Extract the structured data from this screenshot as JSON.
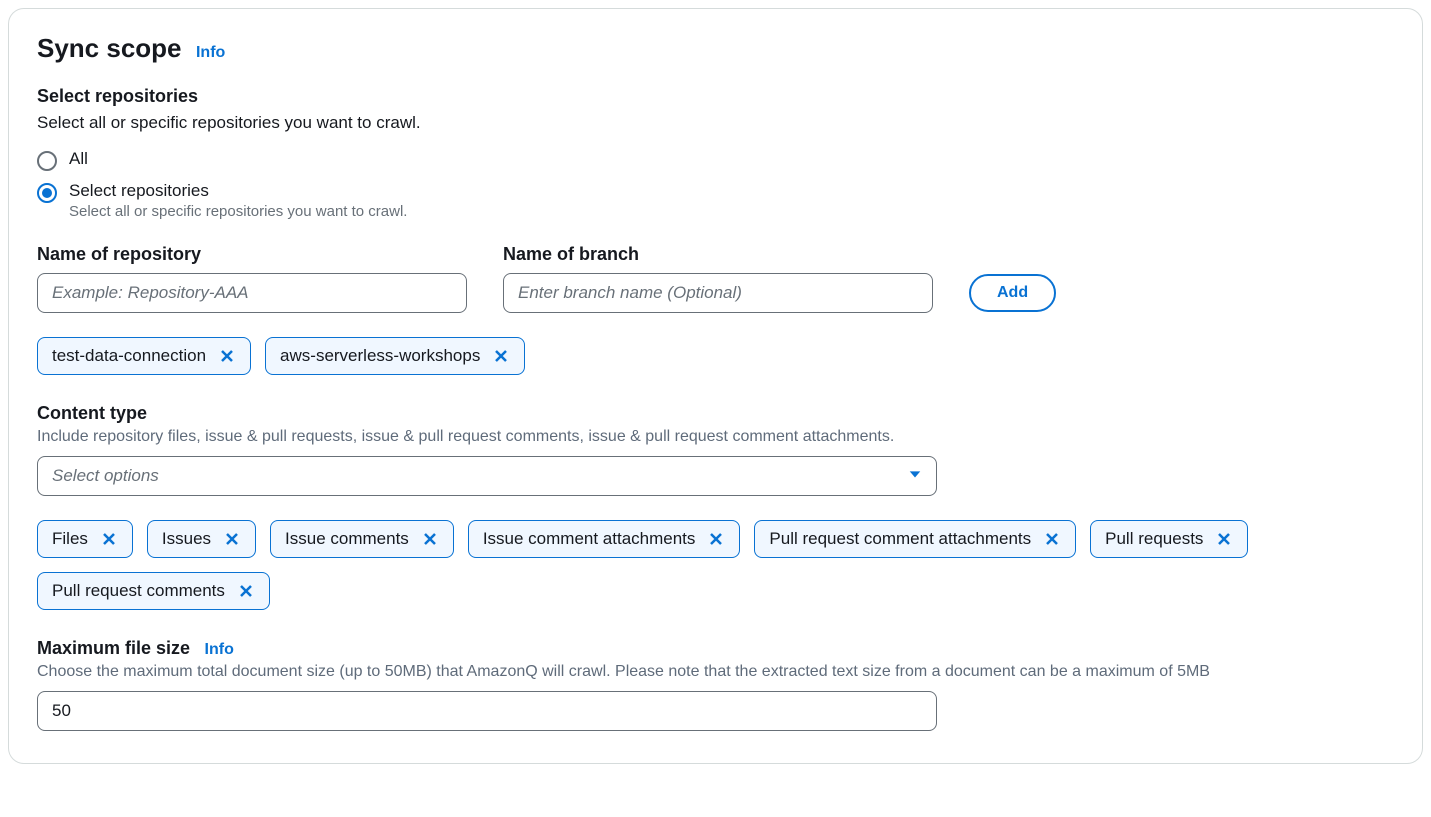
{
  "title": "Sync scope",
  "info_label": "Info",
  "select_repos": {
    "heading": "Select repositories",
    "description": "Select all or specific repositories you want to crawl.",
    "options": [
      {
        "label": "All",
        "selected": false
      },
      {
        "label": "Select repositories",
        "sublabel": "Select all or specific repositories you want to crawl.",
        "selected": true
      }
    ]
  },
  "repo_field": {
    "label": "Name of repository",
    "placeholder": "Example: Repository-AAA",
    "value": ""
  },
  "branch_field": {
    "label": "Name of branch",
    "placeholder": "Enter branch name (Optional)",
    "value": ""
  },
  "add_button": "Add",
  "repo_tokens": [
    "test-data-connection",
    "aws-serverless-workshops"
  ],
  "content_type": {
    "heading": "Content type",
    "description": "Include repository files, issue & pull requests, issue & pull request comments, issue & pull request comment attachments.",
    "select_placeholder": "Select options",
    "tokens": [
      "Files",
      "Issues",
      "Issue comments",
      "Issue comment attachments",
      "Pull request comment attachments",
      "Pull requests",
      "Pull request comments"
    ]
  },
  "max_file_size": {
    "heading": "Maximum file size",
    "info_label": "Info",
    "description": "Choose the maximum total document size (up to 50MB) that AmazonQ will crawl. Please note that the extracted text size from a document can be a maximum of 5MB",
    "value": "50"
  }
}
